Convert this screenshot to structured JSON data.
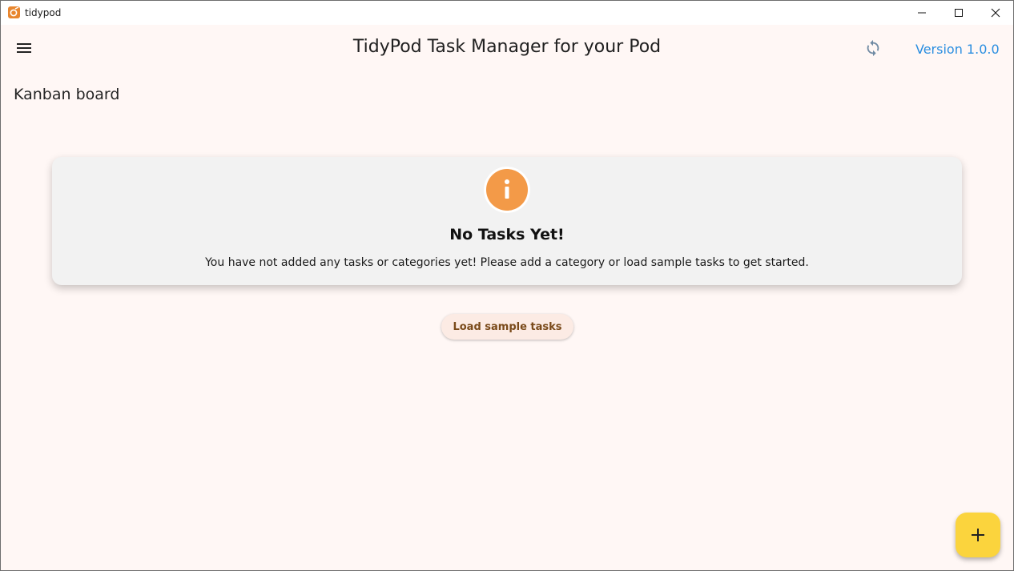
{
  "window": {
    "title": "tidypod"
  },
  "appbar": {
    "title": "TidyPod Task Manager for your Pod",
    "version": "Version 1.0.0"
  },
  "page": {
    "section_title": "Kanban board"
  },
  "empty_state": {
    "heading": "No Tasks Yet!",
    "message": "You have not added any tasks or categories yet! Please add a category or load sample tasks to get started."
  },
  "actions": {
    "load_sample_label": "Load sample tasks"
  },
  "icons": {
    "app": "tidypod-app-icon",
    "menu": "hamburger-menu-icon",
    "sync": "sync-icon",
    "info": "info-icon",
    "add": "plus-icon"
  },
  "colors": {
    "background": "#fff7f5",
    "accent_link": "#2a8ee0",
    "info_orange": "#f39a48",
    "fab_yellow": "#fbd43d",
    "card_bg": "#f2f2f2"
  }
}
